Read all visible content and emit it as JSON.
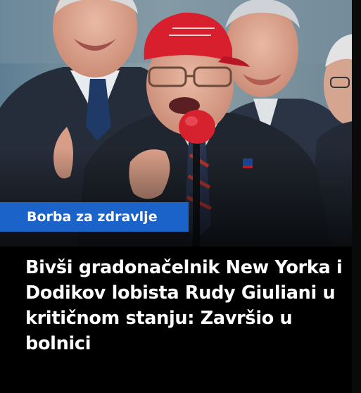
{
  "article": {
    "category": "Borba za zdravlje",
    "headline": "Bivši gradonačelnik New Yorka i Dodikov lobista Rudy Giuliani u kritičnom stanju: Završio u bolnici",
    "photo_alt": "Rudy Giuliani u crvenoj kapi govori u mikrofon"
  },
  "colors": {
    "page_background": "#000000",
    "badge_background": "#1b62c9",
    "badge_text": "#ffffff",
    "headline_text": "#ffffff",
    "cap_red": "#d81f2e"
  },
  "icons": {
    "microphone": "microphone-icon"
  }
}
